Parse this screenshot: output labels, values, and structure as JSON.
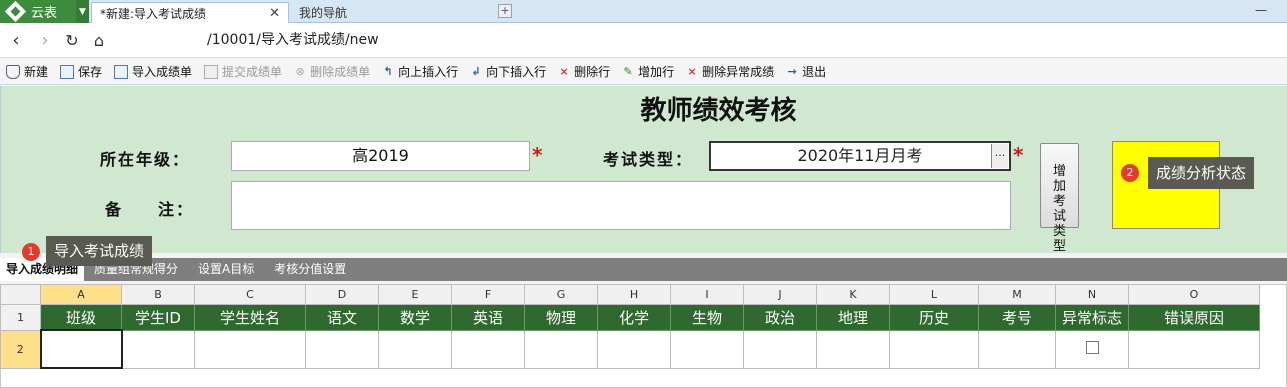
{
  "tabs": {
    "app_label": "云表",
    "active_tab": "*新建:导入考试成绩",
    "second_tab": "我的导航"
  },
  "address": {
    "url": "/10001/导入考试成绩/new"
  },
  "toolbar": [
    {
      "key": "new",
      "label": "新建",
      "icon": "shield-icon",
      "enabled": true
    },
    {
      "key": "save",
      "label": "保存",
      "icon": "save-icon",
      "enabled": true
    },
    {
      "key": "import",
      "label": "导入成绩单",
      "icon": "import-icon",
      "enabled": true
    },
    {
      "key": "submit",
      "label": "提交成绩单",
      "icon": "submit-icon",
      "enabled": false
    },
    {
      "key": "delete",
      "label": "删除成绩单",
      "icon": "delete-circle-icon",
      "enabled": false
    },
    {
      "key": "insert-up",
      "label": "向上插入行",
      "icon": "insert-up-icon",
      "enabled": true
    },
    {
      "key": "insert-down",
      "label": "向下插入行",
      "icon": "insert-down-icon",
      "enabled": true
    },
    {
      "key": "delete-row",
      "label": "删除行",
      "icon": "cross-icon",
      "enabled": true
    },
    {
      "key": "add-row",
      "label": "增加行",
      "icon": "add-row-icon",
      "enabled": true
    },
    {
      "key": "delete-abnormal",
      "label": "删除异常成绩",
      "icon": "cross-icon",
      "enabled": true
    },
    {
      "key": "exit",
      "label": "退出",
      "icon": "arrow-right-icon",
      "enabled": true
    }
  ],
  "form": {
    "title": "教师绩效考核",
    "grade_label": "所在年级：",
    "grade_value": "高2019",
    "exam_type_label": "考试类型：",
    "exam_type_value": "2020年11月月考",
    "exam_ellipsis": "···",
    "remark_label_1": "备",
    "remark_label_2": "注：",
    "remark_value": "",
    "required_mark": "*",
    "add_exam_type_button": "增加考试类型",
    "callout_1_number": "1",
    "callout_1_text": "导入考试成绩",
    "callout_2_number": "2",
    "callout_2_text": "成绩分析状态"
  },
  "subtabs": [
    "导入成绩明细",
    "质量组常规得分",
    "设置A目标",
    "考核分值设置"
  ],
  "sheet": {
    "column_letters": [
      "A",
      "B",
      "C",
      "D",
      "E",
      "F",
      "G",
      "H",
      "I",
      "J",
      "K",
      "L",
      "M",
      "N",
      "O"
    ],
    "headers": [
      "班级",
      "学生ID",
      "学生姓名",
      "语文",
      "数学",
      "英语",
      "物理",
      "化学",
      "生物",
      "政治",
      "地理",
      "历史",
      "考号",
      "异常标志",
      "错误原因"
    ],
    "row_numbers": [
      "1",
      "2"
    ]
  },
  "colors": {
    "app_green": "#3d8b3d",
    "form_bg": "#cfe8cf",
    "header_green": "#2e6a2e",
    "highlight_yellow": "#ffff00",
    "required_red": "#d01818"
  }
}
